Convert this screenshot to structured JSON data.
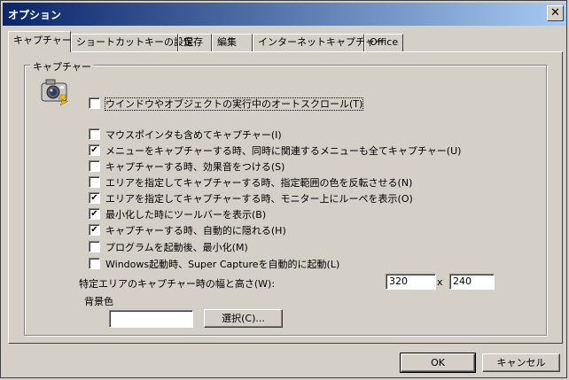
{
  "window": {
    "title": "オプション",
    "close_glyph": "✕"
  },
  "tabs": [
    {
      "label": "キャプチャー",
      "active": true
    },
    {
      "label": "ショートカットキーの設定",
      "active": false
    },
    {
      "label": "保存",
      "active": false
    },
    {
      "label": "編集",
      "active": false
    },
    {
      "label": "インターネットキャプチャー",
      "active": false
    },
    {
      "label": "Office",
      "active": false
    }
  ],
  "group": {
    "title": "キャプチャー",
    "icon": "camera-icon"
  },
  "checkboxes": [
    {
      "label": "ウインドウやオブジェクトの実行中のオートスクロール(T)",
      "checked": false
    },
    {
      "label": "マウスポインタも含めてキャプチャー(I)",
      "checked": false
    },
    {
      "label": "メニューをキャプチャーする時、同時に関連するメニューも全てキャプチャー(U)",
      "checked": true
    },
    {
      "label": "キャプチャーする時、効果音をつける(S)",
      "checked": false
    },
    {
      "label": "エリアを指定してキャプチャーする時、指定範囲の色を反転させる(N)",
      "checked": false
    },
    {
      "label": "エリアを指定してキャプチャーする時、モニター上にルーペを表示(O)",
      "checked": true
    },
    {
      "label": "最小化した時にツールバーを表示(B)",
      "checked": true
    },
    {
      "label": "キャプチャーする時、自動的に隠れる(H)",
      "checked": true
    },
    {
      "label": "プログラムを起動後、最小化(M)",
      "checked": false
    },
    {
      "label": "Windows起動時、Super Captureを自動的に起動(L)",
      "checked": false
    }
  ],
  "size": {
    "label": "特定エリアのキャプチャー時の幅と高さ(W):",
    "width": "320",
    "separator": "x",
    "height": "240"
  },
  "bgcolor": {
    "label": "背景色",
    "value": "",
    "select_label": "選択(C)..."
  },
  "footer": {
    "ok_label": "OK",
    "cancel_label": "キャンセル"
  }
}
